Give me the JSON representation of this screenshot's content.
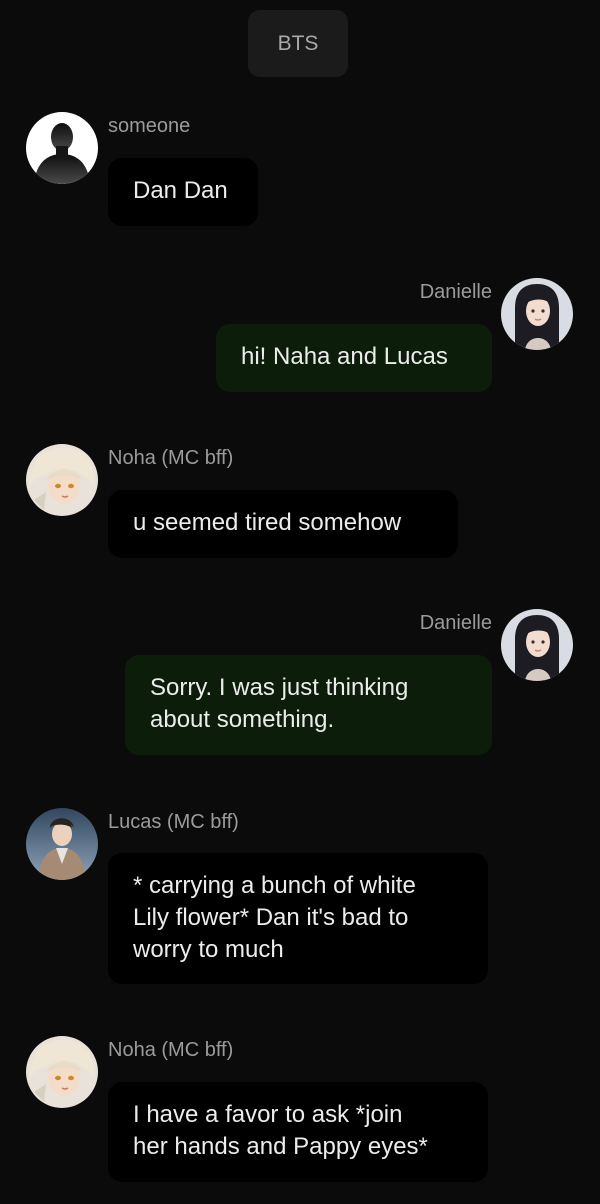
{
  "header": {
    "title": "BTS"
  },
  "colors": {
    "background": "#0b0b0b",
    "incoming_bubble": "#000000",
    "outgoing_bubble": "#0c1e0a",
    "name_text": "#9b9b9b"
  },
  "messages": [
    {
      "side": "left",
      "avatar": "silhouette-avatar",
      "sender": "someone",
      "lines": [
        "Dan Dan"
      ]
    },
    {
      "side": "right",
      "avatar": "girl-avatar",
      "sender": "Danielle",
      "lines": [
        "hi! Naha and Lucas"
      ]
    },
    {
      "side": "left",
      "avatar": "blond-boy-avatar",
      "sender": "Noha (MC bff)",
      "lines": [
        "u seemed tired somehow"
      ]
    },
    {
      "side": "right",
      "avatar": "girl-avatar",
      "sender": "Danielle",
      "lines": [
        "Sorry. I was just thinking",
        "about something."
      ]
    },
    {
      "side": "left",
      "avatar": "dark-hair-boy-avatar",
      "sender": "Lucas (MC bff)",
      "lines": [
        "* carrying a bunch of white",
        "Lily flower* Dan it's bad to",
        "worry to much"
      ]
    },
    {
      "side": "left",
      "avatar": "blond-boy-avatar",
      "sender": "Noha (MC bff)",
      "lines": [
        "I have a favor to ask *join",
        "her hands and Pappy eyes*"
      ]
    }
  ]
}
